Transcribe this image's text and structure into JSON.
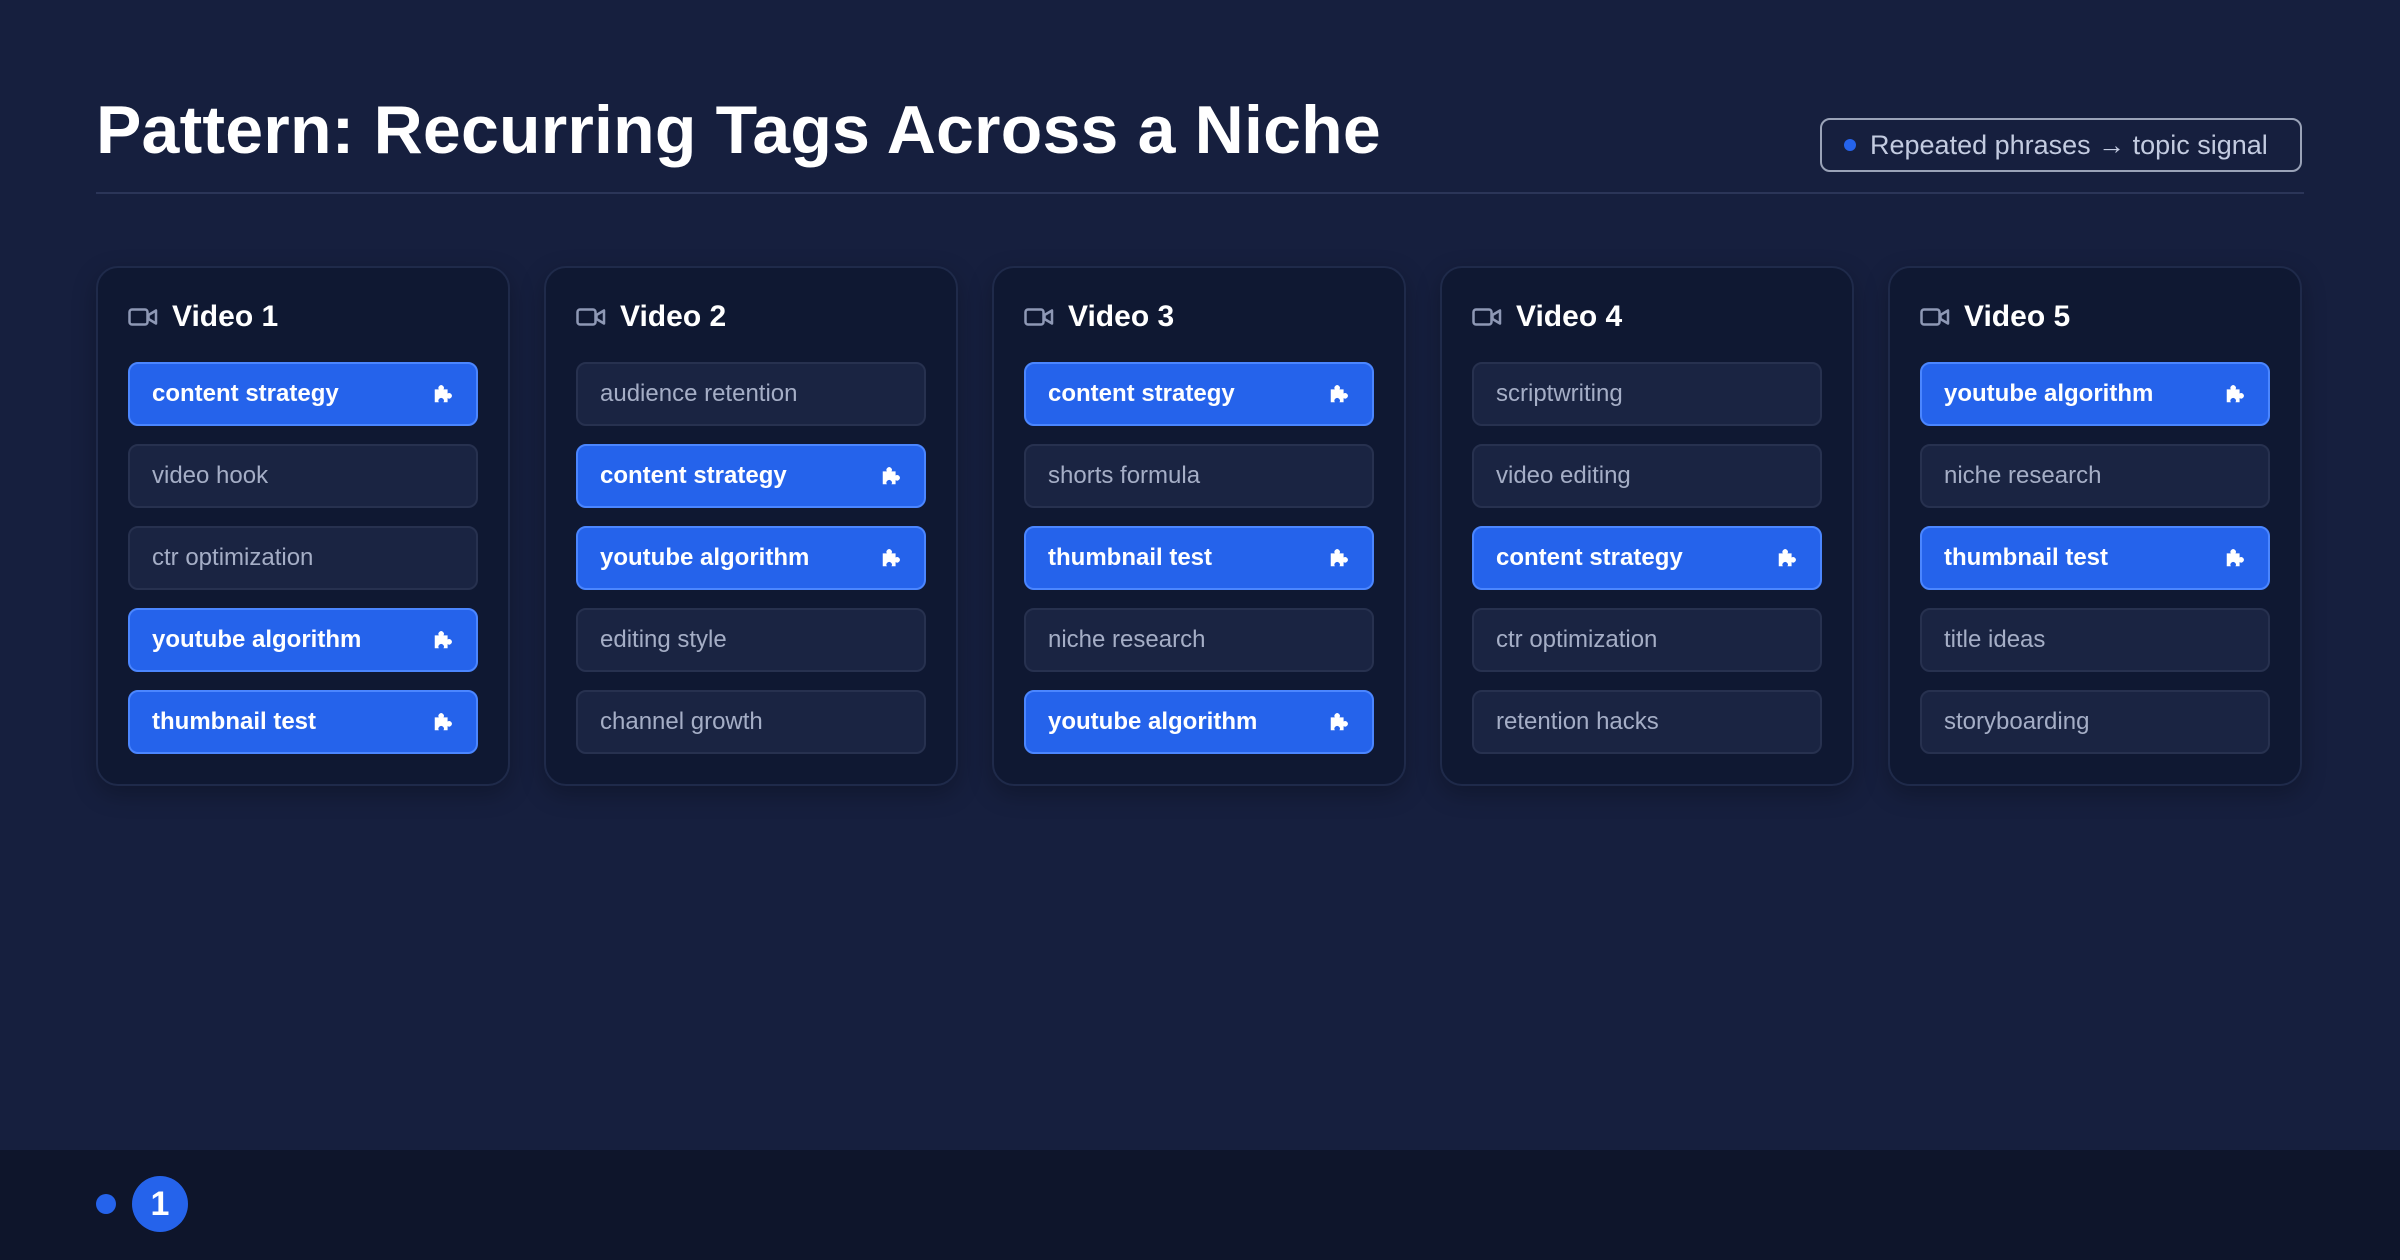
{
  "header": {
    "title": "Pattern: Recurring Tags Across a Niche",
    "badge_text": "Repeated phrases → topic signal"
  },
  "colors": {
    "background": "#161f3e",
    "card": "#0f1832",
    "accent": "#2563eb",
    "plain_tag": "#1a2442"
  },
  "icons": {
    "card_icon": "video-camera-icon",
    "repeated_tag_icon": "puzzle-piece-icon"
  },
  "videos": [
    {
      "title": "Video 1",
      "tags": [
        {
          "label": "content strategy",
          "repeated": true
        },
        {
          "label": "video hook",
          "repeated": false
        },
        {
          "label": "ctr optimization",
          "repeated": false
        },
        {
          "label": "youtube algorithm",
          "repeated": true
        },
        {
          "label": "thumbnail test",
          "repeated": true
        }
      ]
    },
    {
      "title": "Video 2",
      "tags": [
        {
          "label": "audience retention",
          "repeated": false
        },
        {
          "label": "content strategy",
          "repeated": true
        },
        {
          "label": "youtube algorithm",
          "repeated": true
        },
        {
          "label": "editing style",
          "repeated": false
        },
        {
          "label": "channel growth",
          "repeated": false
        }
      ]
    },
    {
      "title": "Video 3",
      "tags": [
        {
          "label": "content strategy",
          "repeated": true
        },
        {
          "label": "shorts formula",
          "repeated": false
        },
        {
          "label": "thumbnail test",
          "repeated": true
        },
        {
          "label": "niche research",
          "repeated": false
        },
        {
          "label": "youtube algorithm",
          "repeated": true
        }
      ]
    },
    {
      "title": "Video 4",
      "tags": [
        {
          "label": "scriptwriting",
          "repeated": false
        },
        {
          "label": "video editing",
          "repeated": false
        },
        {
          "label": "content strategy",
          "repeated": true
        },
        {
          "label": "ctr optimization",
          "repeated": false
        },
        {
          "label": "retention hacks",
          "repeated": false
        }
      ]
    },
    {
      "title": "Video 5",
      "tags": [
        {
          "label": "youtube algorithm",
          "repeated": true
        },
        {
          "label": "niche research",
          "repeated": false
        },
        {
          "label": "thumbnail test",
          "repeated": true
        },
        {
          "label": "title ideas",
          "repeated": false
        },
        {
          "label": "storyboarding",
          "repeated": false
        }
      ]
    }
  ],
  "footer": {
    "page_number": "1"
  }
}
